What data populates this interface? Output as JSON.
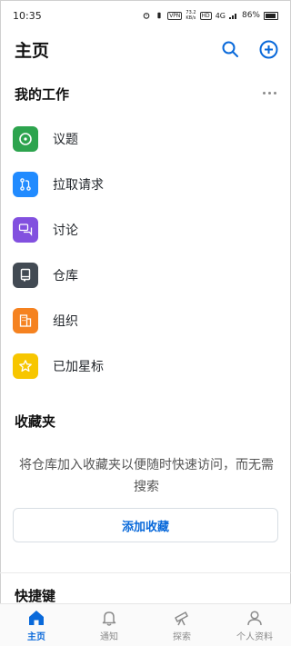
{
  "status_bar": {
    "time": "10:35",
    "net_speed": "73.2",
    "net_unit": "KB/s",
    "network": "4G",
    "vpn": "VPN",
    "hd": "HD",
    "battery": "86%"
  },
  "header": {
    "title": "主页"
  },
  "my_work": {
    "title": "我的工作",
    "items": [
      {
        "label": "议题",
        "color": "#2da44e",
        "icon": "issue-icon"
      },
      {
        "label": "拉取请求",
        "color": "#218bff",
        "icon": "pull-request-icon"
      },
      {
        "label": "讨论",
        "color": "#8250df",
        "icon": "discussion-icon"
      },
      {
        "label": "仓库",
        "color": "#424a53",
        "icon": "repo-icon"
      },
      {
        "label": "组织",
        "color": "#f58220",
        "icon": "organization-icon"
      },
      {
        "label": "已加星标",
        "color": "#f7c600",
        "icon": "star-icon"
      }
    ]
  },
  "favorites": {
    "title": "收藏夹",
    "description": "将仓库加入收藏夹以便随时快速访问，而无需搜索",
    "add_button": "添加收藏"
  },
  "shortcuts": {
    "title": "快捷键"
  },
  "bottom_nav": [
    {
      "label": "主页",
      "icon": "home-icon",
      "active": true
    },
    {
      "label": "通知",
      "icon": "bell-icon",
      "active": false
    },
    {
      "label": "探索",
      "icon": "telescope-icon",
      "active": false
    },
    {
      "label": "个人资料",
      "icon": "person-icon",
      "active": false
    }
  ],
  "colors": {
    "accent": "#0969da"
  }
}
